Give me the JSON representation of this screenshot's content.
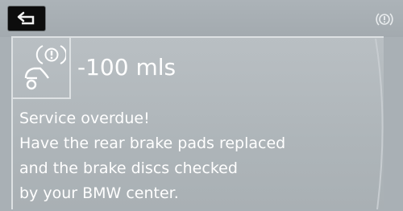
{
  "header": {
    "back_icon": "back-arrow-icon",
    "status_icon": "warning-exclamation-icon"
  },
  "service": {
    "icon": "brake-pad-warning-icon",
    "distance": "-100 mls",
    "message_lines": [
      "Service overdue!",
      "Have the rear brake pads replaced",
      "and the brake discs checked",
      "by your BMW center."
    ]
  },
  "colors": {
    "background": "#a9b0b5",
    "text": "#ffffff",
    "back_button": "#0d0d0d",
    "panel_border": "#dde1e3"
  }
}
